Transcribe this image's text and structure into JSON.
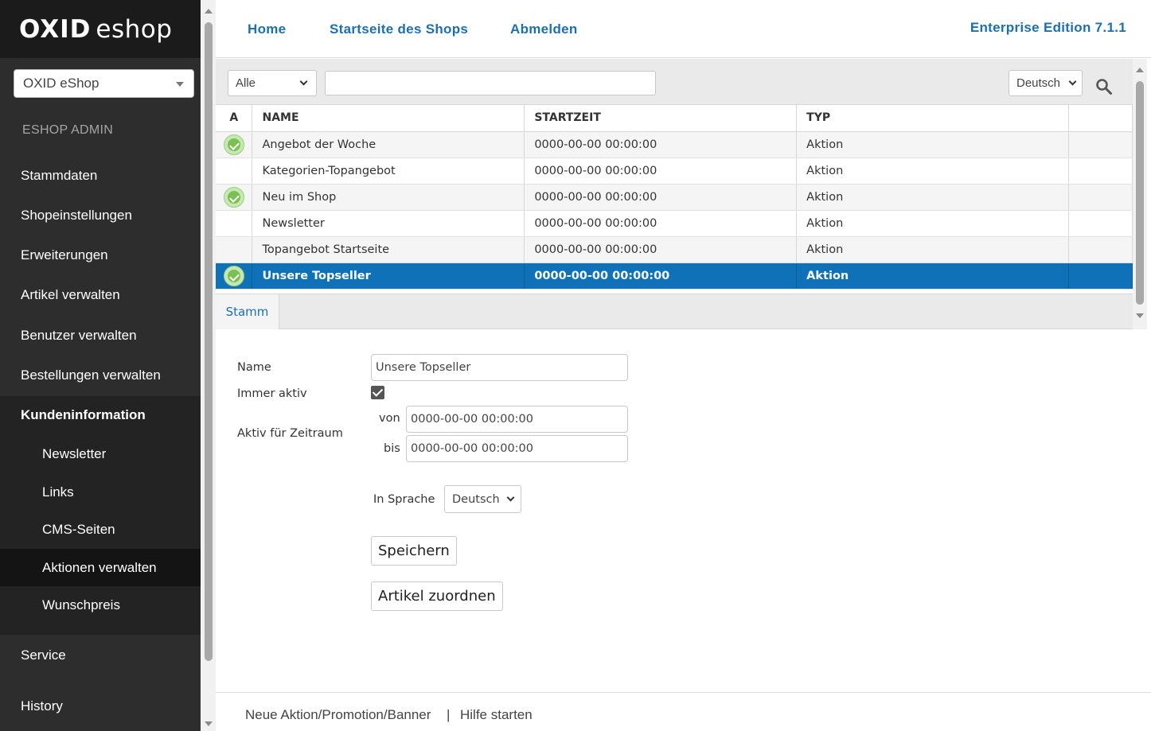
{
  "sidebar": {
    "logo_bold": "OXID",
    "logo_light": "eshop",
    "shop_select": "OXID eShop",
    "admin_label": "ESHOP ADMIN",
    "items": [
      {
        "label": "Stammdaten"
      },
      {
        "label": "Shopeinstellungen"
      },
      {
        "label": "Erweiterungen"
      },
      {
        "label": "Artikel verwalten"
      },
      {
        "label": "Benutzer verwalten"
      },
      {
        "label": "Bestellungen verwalten"
      },
      {
        "label": "Kundeninformation"
      }
    ],
    "sub_items": [
      {
        "label": "Newsletter"
      },
      {
        "label": "Links"
      },
      {
        "label": "CMS-Seiten"
      },
      {
        "label": "Aktionen verwalten"
      },
      {
        "label": "Wunschpreis"
      }
    ],
    "bottom_items": [
      {
        "label": "Service"
      },
      {
        "label": "History"
      }
    ]
  },
  "header": {
    "links": [
      {
        "label": "Home"
      },
      {
        "label": "Startseite des Shops"
      },
      {
        "label": "Abmelden"
      }
    ],
    "edition": "Enterprise Edition 7.1.1"
  },
  "filter": {
    "type_value": "Alle",
    "search_value": "",
    "language_value": "Deutsch"
  },
  "list": {
    "columns": [
      "A",
      "NAME",
      "STARTZEIT",
      "TYP"
    ],
    "rows": [
      {
        "active": true,
        "name": "Angebot der Woche",
        "start": "0000-00-00 00:00:00",
        "type": "Aktion"
      },
      {
        "active": false,
        "name": "Kategorien-Topangebot",
        "start": "0000-00-00 00:00:00",
        "type": "Aktion"
      },
      {
        "active": true,
        "name": "Neu im Shop",
        "start": "0000-00-00 00:00:00",
        "type": "Aktion"
      },
      {
        "active": false,
        "name": "Newsletter",
        "start": "0000-00-00 00:00:00",
        "type": "Aktion"
      },
      {
        "active": false,
        "name": "Topangebot Startseite",
        "start": "0000-00-00 00:00:00",
        "type": "Aktion"
      },
      {
        "active": true,
        "name": "Unsere Topseller",
        "start": "0000-00-00 00:00:00",
        "type": "Aktion",
        "selected": true
      }
    ]
  },
  "tabs": [
    {
      "label": "Stamm"
    }
  ],
  "form": {
    "name_label": "Name",
    "name_value": "Unsere Topseller",
    "always_active_label": "Immer aktiv",
    "always_active_checked": true,
    "period_label": "Aktiv für Zeitraum",
    "from_label": "von",
    "from_value": "0000-00-00 00:00:00",
    "to_label": "bis",
    "to_value": "0000-00-00 00:00:00",
    "language_label": "In Sprache",
    "language_value": "Deutsch",
    "save_label": "Speichern",
    "assign_label": "Artikel zuordnen"
  },
  "footer": {
    "new_link": "Neue Aktion/Promotion/Banner",
    "separator": "|",
    "help_link": "Hilfe starten"
  },
  "colors": {
    "sidebar_bg": "#2d2d2d",
    "accent": "#1d6fae",
    "selected_row": "#0f72b8",
    "active_green": "#7cbf53"
  }
}
